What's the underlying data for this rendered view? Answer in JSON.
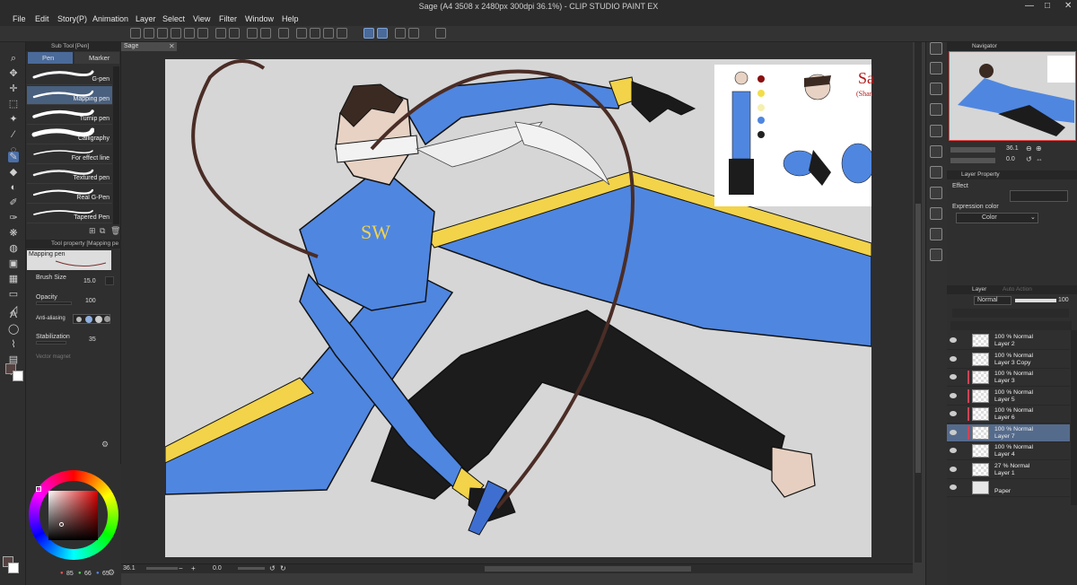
{
  "window": {
    "title": "Sage (A4 3508 x 2480px 300dpi 36.1%) - CLIP STUDIO PAINT EX",
    "minimize": "—",
    "maximize": "□",
    "close": "✕"
  },
  "menu": [
    "File",
    "Edit",
    "Story(P)",
    "Animation",
    "Layer",
    "Select",
    "View",
    "Filter",
    "Window",
    "Help"
  ],
  "subtool": {
    "header": "Sub Tool [Pen]",
    "tabs": [
      "Pen",
      "Marker"
    ],
    "brushes": [
      "G-pen",
      "Mapping pen",
      "Turnip pen",
      "Calligraphy",
      "For effect line",
      "Textured pen",
      "Real G-Pen",
      "Tapered Pen"
    ],
    "selected_index": 1
  },
  "toolprop": {
    "header": "Tool property [Mapping pe",
    "preview_label": "Mapping pen",
    "brush_size_label": "Brush Size",
    "brush_size_value": "15.0",
    "opacity_label": "Opacity",
    "opacity_value": "100",
    "antialias_label": "Anti-aliasing",
    "stabilization_label": "Stabilization",
    "stabilization_value": "35",
    "vector_magnet_label": "Vector magnet"
  },
  "color": {
    "r": "85",
    "g": "66",
    "b": "65",
    "main": "#554241",
    "sub": "#ffffff"
  },
  "document": {
    "tab": "Sage",
    "zoom": "36.1",
    "rotation": "0.0"
  },
  "reference_sheet": {
    "title": "Sa",
    "subtitle": "(Shan",
    "swatches": [
      "#8a1010",
      "#f2dd4a",
      "#f5f0b0",
      "#4f86e0",
      "#222222"
    ]
  },
  "navigator": {
    "header": "Navigator",
    "zoom": "36.1",
    "rotation": "0.0"
  },
  "layer_property": {
    "header": "Layer Property",
    "effect_label": "Effect",
    "expression_label": "Expression color",
    "expression_value": "Color"
  },
  "layers": {
    "header_tabs": [
      "Layer",
      "Auto Action"
    ],
    "blend": "Normal",
    "opacity": "100",
    "items": [
      {
        "line1": "100 % Normal",
        "line2": "Layer 2",
        "selected": false,
        "mark": false
      },
      {
        "line1": "100 % Normal",
        "line2": "Layer 3 Copy",
        "selected": false,
        "mark": false
      },
      {
        "line1": "100 % Normal",
        "line2": "Layer 3",
        "selected": false,
        "mark": true
      },
      {
        "line1": "100 % Normal",
        "line2": "Layer 5",
        "selected": false,
        "mark": true
      },
      {
        "line1": "100 % Normal",
        "line2": "Layer 6",
        "selected": false,
        "mark": true
      },
      {
        "line1": "100 % Normal",
        "line2": "Layer 7",
        "selected": true,
        "mark": true
      },
      {
        "line1": "100 % Normal",
        "line2": "Layer 4",
        "selected": false,
        "mark": false
      },
      {
        "line1": "27 % Normal",
        "line2": "Layer 1",
        "selected": false,
        "mark": false
      },
      {
        "line1": "",
        "line2": "Paper",
        "selected": false,
        "mark": false
      }
    ]
  },
  "colors": {
    "accent": "#4b6fa8",
    "coat_blue": "#4f86e0",
    "trim_yellow": "#f2d34a",
    "pants": "#1c1c1c"
  }
}
